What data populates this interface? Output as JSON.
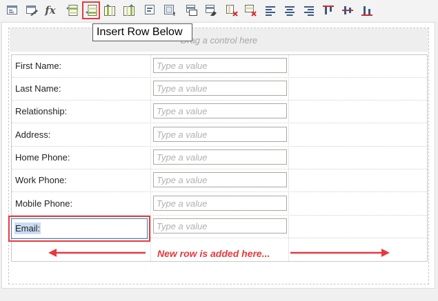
{
  "toolbar": {
    "buttons": [
      {
        "id": "properties",
        "icon": "form-properties-icon"
      },
      {
        "id": "edit",
        "icon": "form-edit-icon"
      },
      {
        "id": "formula",
        "icon": "formula-icon",
        "glyph": "fx"
      },
      {
        "id": "insert-row-above",
        "icon": "insert-row-above-icon"
      },
      {
        "id": "insert-row-below",
        "icon": "insert-row-below-icon",
        "active": true
      },
      {
        "id": "insert-column-left",
        "icon": "insert-column-left-icon"
      },
      {
        "id": "insert-column-right",
        "icon": "insert-column-right-icon"
      },
      {
        "id": "add-control",
        "icon": "add-control-icon"
      },
      {
        "id": "add-panel",
        "icon": "add-panel-icon"
      },
      {
        "id": "copy-row",
        "icon": "copy-row-icon"
      },
      {
        "id": "erase-row",
        "icon": "erase-row-icon"
      },
      {
        "id": "delete-column",
        "icon": "delete-column-icon"
      },
      {
        "id": "delete-row",
        "icon": "delete-row-icon"
      },
      {
        "id": "align-left",
        "icon": "align-left-icon"
      },
      {
        "id": "align-center",
        "icon": "align-center-icon"
      },
      {
        "id": "align-right",
        "icon": "align-right-icon"
      },
      {
        "id": "align-top",
        "icon": "align-top-icon"
      },
      {
        "id": "align-middle",
        "icon": "align-middle-icon"
      },
      {
        "id": "align-bottom",
        "icon": "align-bottom-icon"
      }
    ],
    "tooltip": "Insert Row Below"
  },
  "canvas": {
    "drop_hint": "Drag a control here"
  },
  "form": {
    "placeholder": "Type a value",
    "rows": [
      {
        "label": "First Name:"
      },
      {
        "label": "Last Name:"
      },
      {
        "label": "Relationship:"
      },
      {
        "label": "Address:"
      },
      {
        "label": "Home Phone:"
      },
      {
        "label": "Work Phone:"
      },
      {
        "label": "Mobile Phone:"
      },
      {
        "label": "Email:"
      }
    ]
  },
  "annotation": {
    "text": "New row is added here...",
    "color": "#e8383d"
  },
  "colors": {
    "highlight": "#e8383d",
    "selection": "#c9dcf2"
  }
}
